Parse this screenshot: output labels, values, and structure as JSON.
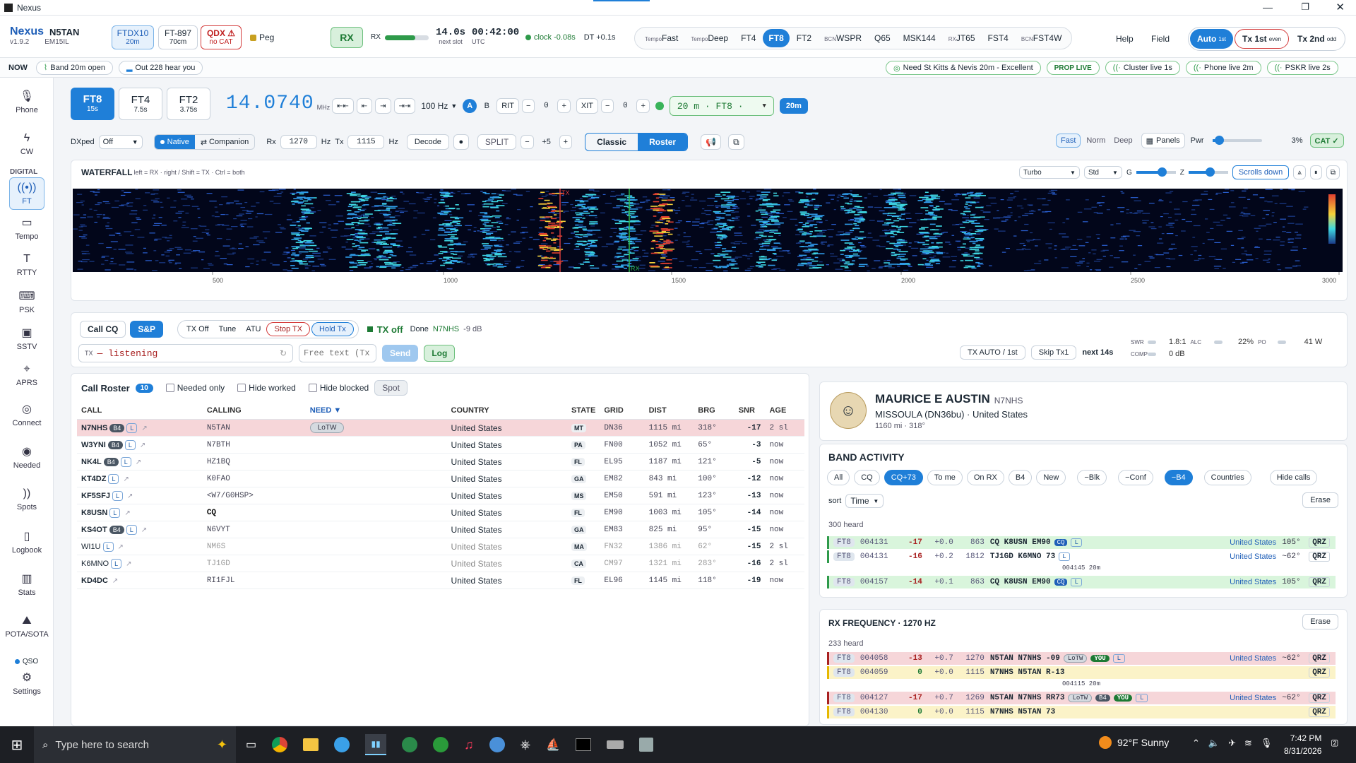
{
  "window": {
    "title": "Nexus"
  },
  "header": {
    "brand": "Nexus",
    "version": "v1.9.2",
    "callsign": "N5TAN",
    "grid": "EM15IL",
    "rig1": {
      "name": "FTDX10",
      "sub": "20m"
    },
    "rig2": {
      "name": "FT-897",
      "sub": "70cm"
    },
    "rig3": {
      "name": "QDX ⚠",
      "sub": "no CAT"
    },
    "peg": "Peg",
    "rx": "RX",
    "rx_label": "RX",
    "slot_time": "14.0s",
    "slot_sub": "next slot",
    "utc_time": "00:42:00",
    "utc_sub": "UTC",
    "clock": "clock -0.08s",
    "dt": "DT +0.1s",
    "modes": [
      {
        "pre": "Tempo",
        "label": "Fast"
      },
      {
        "pre": "Tempo",
        "label": "Deep"
      },
      {
        "pre": "",
        "label": "FT4"
      },
      {
        "pre": "",
        "label": "FT8"
      },
      {
        "pre": "",
        "label": "FT2"
      },
      {
        "pre": "BCN",
        "label": "WSPR"
      },
      {
        "pre": "",
        "label": "Q65"
      },
      {
        "pre": "",
        "label": "MSK144"
      },
      {
        "pre": "RX",
        "label": "JT65"
      },
      {
        "pre": "",
        "label": "FST4"
      },
      {
        "pre": "BCN",
        "label": "FST4W"
      }
    ],
    "help": "Help",
    "field": "Field",
    "auto": "Auto",
    "auto_sub": "1st",
    "tx1": "Tx 1st",
    "tx1_sub": "even",
    "tx2": "Tx 2nd",
    "tx2_sub": "odd"
  },
  "nowbar": {
    "now": "NOW",
    "band": "Band  20m open",
    "out": "Out  228 hear you",
    "need": "Need  St Kitts & Nevis 20m - Excellent",
    "prop": "PROP LIVE",
    "cluster": "Cluster  live 1s",
    "phone": "Phone  live 2m",
    "pskr": "PSKR  live 2s"
  },
  "sidebar": {
    "items": [
      "Phone",
      "CW"
    ],
    "digital": "DIGITAL",
    "digital_items": [
      "FT",
      "Tempo",
      "RTTY",
      "PSK",
      "SSTV",
      "APRS"
    ],
    "other": [
      "Connect",
      "Needed",
      "Spots",
      "Logbook",
      "Stats",
      "POTA/SOTA"
    ],
    "qso": "QSO",
    "settings": "Settings"
  },
  "control": {
    "modes": [
      {
        "name": "FT8",
        "sub": "15s"
      },
      {
        "name": "FT4",
        "sub": "7.5s"
      },
      {
        "name": "FT2",
        "sub": "3.75s"
      }
    ],
    "freq": "14.0740",
    "freq_unit": "MHz",
    "step": "100 Hz",
    "a": "A",
    "b": "B",
    "rit": "RIT",
    "rit_val": "0",
    "xit": "XIT",
    "xit_val": "0",
    "band_select": "20 m · FT8 ·",
    "band_btn": "20m",
    "dxped": "DXped",
    "dxped_val": "Off",
    "native": "Native",
    "companion": "Companion",
    "rx": "Rx",
    "rx_val": "1270",
    "hz": "Hz",
    "tx": "Tx",
    "tx_val": "1115",
    "decode": "Decode",
    "split": "SPLIT",
    "split_val": "+5",
    "classic": "Classic",
    "roster": "Roster",
    "fast": "Fast",
    "norm": "Norm",
    "deep": "Deep",
    "panels": "Panels",
    "pwr": "Pwr",
    "pwr_val": "3%",
    "cat": "CAT ✓"
  },
  "waterfall": {
    "title": "WATERFALL",
    "hint": "left = RX · right / Shift = TX · Ctrl = both",
    "speed": "Turbo",
    "std": "Std",
    "g": "G",
    "z": "Z",
    "scroll": "Scrolls down",
    "tx_mark": "TX",
    "rx_mark": "RX",
    "ticks": [
      "500",
      "1000",
      "1500",
      "2000",
      "2500",
      "3000"
    ]
  },
  "txbar": {
    "callcq": "Call CQ",
    "sp": "S&P",
    "txoff": "TX Off",
    "tune": "Tune",
    "atu": "ATU",
    "stoptx": "Stop TX",
    "holdtx": "Hold Tx",
    "status": "TX off",
    "done": "Done",
    "done_call": "N7NHS",
    "done_db": "-9 dB",
    "tx_label": "TX",
    "tx_state": "— listening",
    "free_placeholder": "Free text (Tx!",
    "send": "Send",
    "log": "Log",
    "txauto": "TX AUTO / 1st",
    "skip": "Skip Tx1",
    "next": "next 14s",
    "swr": "SWR",
    "swr_val": "1.8:1",
    "alc": "ALC",
    "po_val": "22%",
    "po": "PO",
    "watts": "41 W",
    "comp": "COMP",
    "comp_val": "0 dB"
  },
  "roster": {
    "title": "Call Roster",
    "count": "10",
    "needed": "Needed only",
    "hideworked": "Hide worked",
    "hideblocked": "Hide blocked",
    "spot": "Spot",
    "cols": [
      "CALL",
      "CALLING",
      "NEED ▼",
      "COUNTRY",
      "STATE",
      "GRID",
      "DIST",
      "BRG",
      "SNR",
      "AGE"
    ],
    "rows": [
      {
        "call": "N7NHS",
        "b4": "B4",
        "l": "L",
        "calling": "N5TAN",
        "need": "LoTW",
        "country": "United States",
        "state": "MT",
        "grid": "DN36",
        "dist": "1115 mi",
        "brg": "318°",
        "snr": "-17",
        "age": "2 sl"
      },
      {
        "call": "W3YNI",
        "b4": "B4",
        "l": "L",
        "calling": "N7BTH",
        "need": "",
        "country": "United States",
        "state": "PA",
        "grid": "FN00",
        "dist": "1052 mi",
        "brg": "65°",
        "snr": "-3",
        "age": "now"
      },
      {
        "call": "NK4L",
        "b4": "B4",
        "l": "L",
        "calling": "HZ1BQ",
        "need": "",
        "country": "United States",
        "state": "FL",
        "grid": "EL95",
        "dist": "1187 mi",
        "brg": "121°",
        "snr": "-5",
        "age": "now"
      },
      {
        "call": "KT4DZ",
        "b4": "",
        "l": "L",
        "calling": "K0FAO",
        "need": "",
        "country": "United States",
        "state": "GA",
        "grid": "EM82",
        "dist": "843 mi",
        "brg": "100°",
        "snr": "-12",
        "age": "now"
      },
      {
        "call": "KF5SFJ",
        "b4": "",
        "l": "L",
        "calling": "<W7/G0HSP>",
        "need": "",
        "country": "United States",
        "state": "MS",
        "grid": "EM50",
        "dist": "591 mi",
        "brg": "123°",
        "snr": "-13",
        "age": "now"
      },
      {
        "call": "K8USN",
        "b4": "",
        "l": "L",
        "calling": "CQ",
        "need": "",
        "country": "United States",
        "state": "FL",
        "grid": "EM90",
        "dist": "1003 mi",
        "brg": "105°",
        "snr": "-14",
        "age": "now"
      },
      {
        "call": "KS4OT",
        "b4": "B4",
        "l": "L",
        "calling": "N6VYT",
        "need": "",
        "country": "United States",
        "state": "GA",
        "grid": "EM83",
        "dist": "825 mi",
        "brg": "95°",
        "snr": "-15",
        "age": "now"
      },
      {
        "call": "WI1U",
        "b4": "",
        "l": "L",
        "calling": "NM6S",
        "need": "",
        "country": "United States",
        "state": "MA",
        "grid": "FN32",
        "dist": "1386 mi",
        "brg": "62°",
        "snr": "-15",
        "age": "2 sl"
      },
      {
        "call": "K6MNO",
        "b4": "",
        "l": "L",
        "calling": "TJ1GD",
        "need": "",
        "country": "United States",
        "state": "CA",
        "grid": "CM97",
        "dist": "1321 mi",
        "brg": "283°",
        "snr": "-16",
        "age": "2 sl"
      },
      {
        "call": "KD4DC",
        "b4": "",
        "l": "",
        "calling": "RI1FJL",
        "need": "",
        "country": "United States",
        "state": "FL",
        "grid": "EL96",
        "dist": "1145 mi",
        "brg": "118°",
        "snr": "-19",
        "age": "now"
      }
    ]
  },
  "profile": {
    "name": "MAURICE E AUSTIN",
    "call": "N7NHS",
    "loc": "MISSOULA (DN36bu) · United States",
    "dist": "1160 mi · 318°"
  },
  "band": {
    "title": "BAND ACTIVITY",
    "filters": [
      "All",
      "CQ",
      "CQ+73",
      "To me",
      "On RX",
      "B4",
      "New",
      "−Blk",
      "−Conf",
      "−B4",
      "Countries",
      "Hide calls"
    ],
    "sort": "sort",
    "sort_val": "Time",
    "erase": "Erase",
    "heard": "300 heard",
    "rows": [
      {
        "mode": "FT8",
        "time": "004131",
        "snr": "-17",
        "dt": "+0.0",
        "freq": "863",
        "msg": "CQ K8USN EM90",
        "cq": "CQ",
        "l": "L",
        "country": "United States",
        "brg": "105°",
        "qrz": "QRZ"
      },
      {
        "mode": "FT8",
        "time": "004131",
        "snr": "-16",
        "dt": "+0.2",
        "freq": "1812",
        "msg": "TJ1GD K6MNO 73",
        "cq": "",
        "l": "L",
        "country": "United States",
        "brg": "~62°",
        "qrz": "QRZ"
      },
      {
        "mode": "FT8",
        "time": "004157",
        "snr": "-14",
        "dt": "+0.1",
        "freq": "863",
        "msg": "CQ K8USN EM90",
        "cq": "CQ",
        "l": "L",
        "country": "United States",
        "brg": "105°",
        "qrz": "QRZ"
      }
    ],
    "sep": "004145  20m"
  },
  "rxfreq": {
    "title": "RX FREQUENCY · 1270 HZ",
    "erase": "Erase",
    "heard": "233 heard",
    "sep": "004115  20m",
    "rows": [
      {
        "mode": "FT8",
        "time": "004058",
        "snr": "-13",
        "dt": "+0.7",
        "freq": "1270",
        "msg": "N5TAN N7NHS -09",
        "tags": [
          "LoTW",
          "YOU",
          "L"
        ],
        "country": "United States",
        "brg": "~62°",
        "qrz": "QRZ"
      },
      {
        "mode": "FT8",
        "time": "004059",
        "snr": "0",
        "dt": "+0.0",
        "freq": "1115",
        "msg": "N7NHS N5TAN R-13",
        "tags": [],
        "country": "",
        "brg": "",
        "qrz": "QRZ"
      },
      {
        "mode": "FT8",
        "time": "004127",
        "snr": "-17",
        "dt": "+0.7",
        "freq": "1269",
        "msg": "N5TAN N7NHS RR73",
        "tags": [
          "LoTW",
          "B4",
          "YOU",
          "L"
        ],
        "country": "United States",
        "brg": "~62°",
        "qrz": "QRZ"
      },
      {
        "mode": "FT8",
        "time": "004130",
        "snr": "0",
        "dt": "+0.0",
        "freq": "1115",
        "msg": "N7NHS N5TAN 73",
        "tags": [],
        "country": "",
        "brg": "",
        "qrz": "QRZ"
      }
    ]
  },
  "taskbar": {
    "search": "Type here to search",
    "weather": "92°F  Sunny",
    "time": "7:42 PM",
    "date": "8/31/2026",
    "notif": "2"
  }
}
